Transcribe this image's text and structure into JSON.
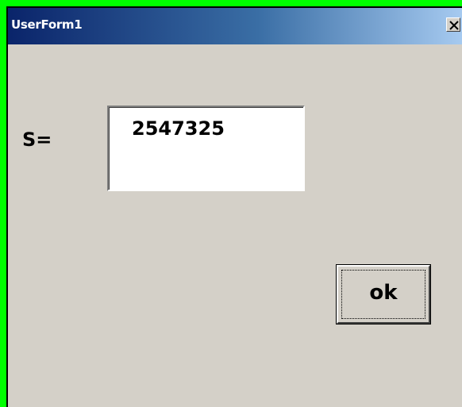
{
  "window": {
    "title": "UserForm1"
  },
  "form": {
    "label": "S=",
    "value": "2547325"
  },
  "buttons": {
    "ok_label": "ok",
    "close_icon": "close-icon"
  },
  "colors": {
    "background_outer": "#00ff00",
    "form_bg": "#d4d0c8",
    "titlebar_start": "#0a246a",
    "titlebar_end": "#a6caf0"
  }
}
